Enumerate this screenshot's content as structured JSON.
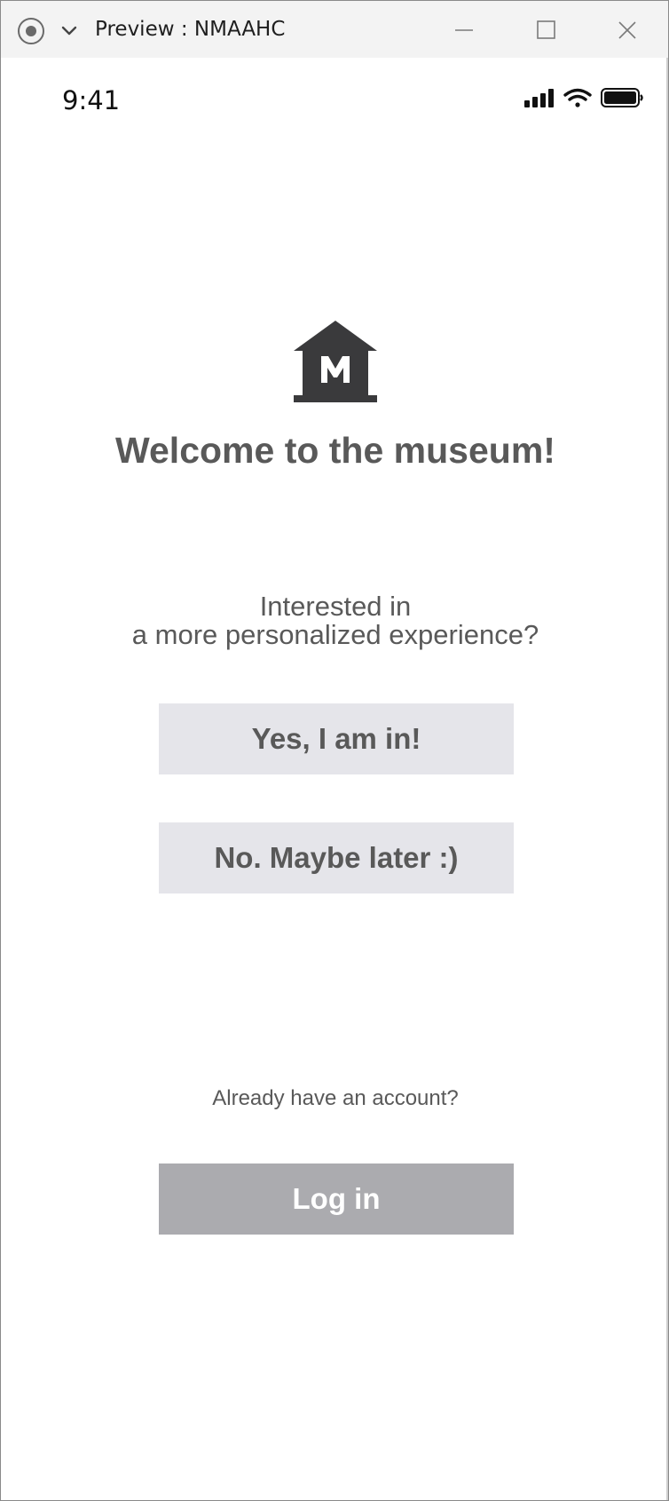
{
  "window": {
    "title": "Preview : NMAAHC",
    "icons": [
      "record-icon",
      "chevron-down-icon",
      "minimize-icon",
      "maximize-icon",
      "close-icon"
    ]
  },
  "status_bar": {
    "time": "9:41",
    "icons": [
      "signal-icon",
      "wifi-icon",
      "battery-icon"
    ]
  },
  "main": {
    "logo_letter": "M",
    "welcome": "Welcome to the museum!",
    "prompt_line1": "Interested in",
    "prompt_line2": "a more personalized experience?",
    "yes_label": "Yes, I am in!",
    "no_label": "No. Maybe later :)",
    "account_prompt": "Already have an account?",
    "login_label": "Log in"
  },
  "colors": {
    "text_gray": "#595959",
    "button_light": "#e5e5ea",
    "button_dark": "#ababaf",
    "logo": "#3a3a3c"
  }
}
